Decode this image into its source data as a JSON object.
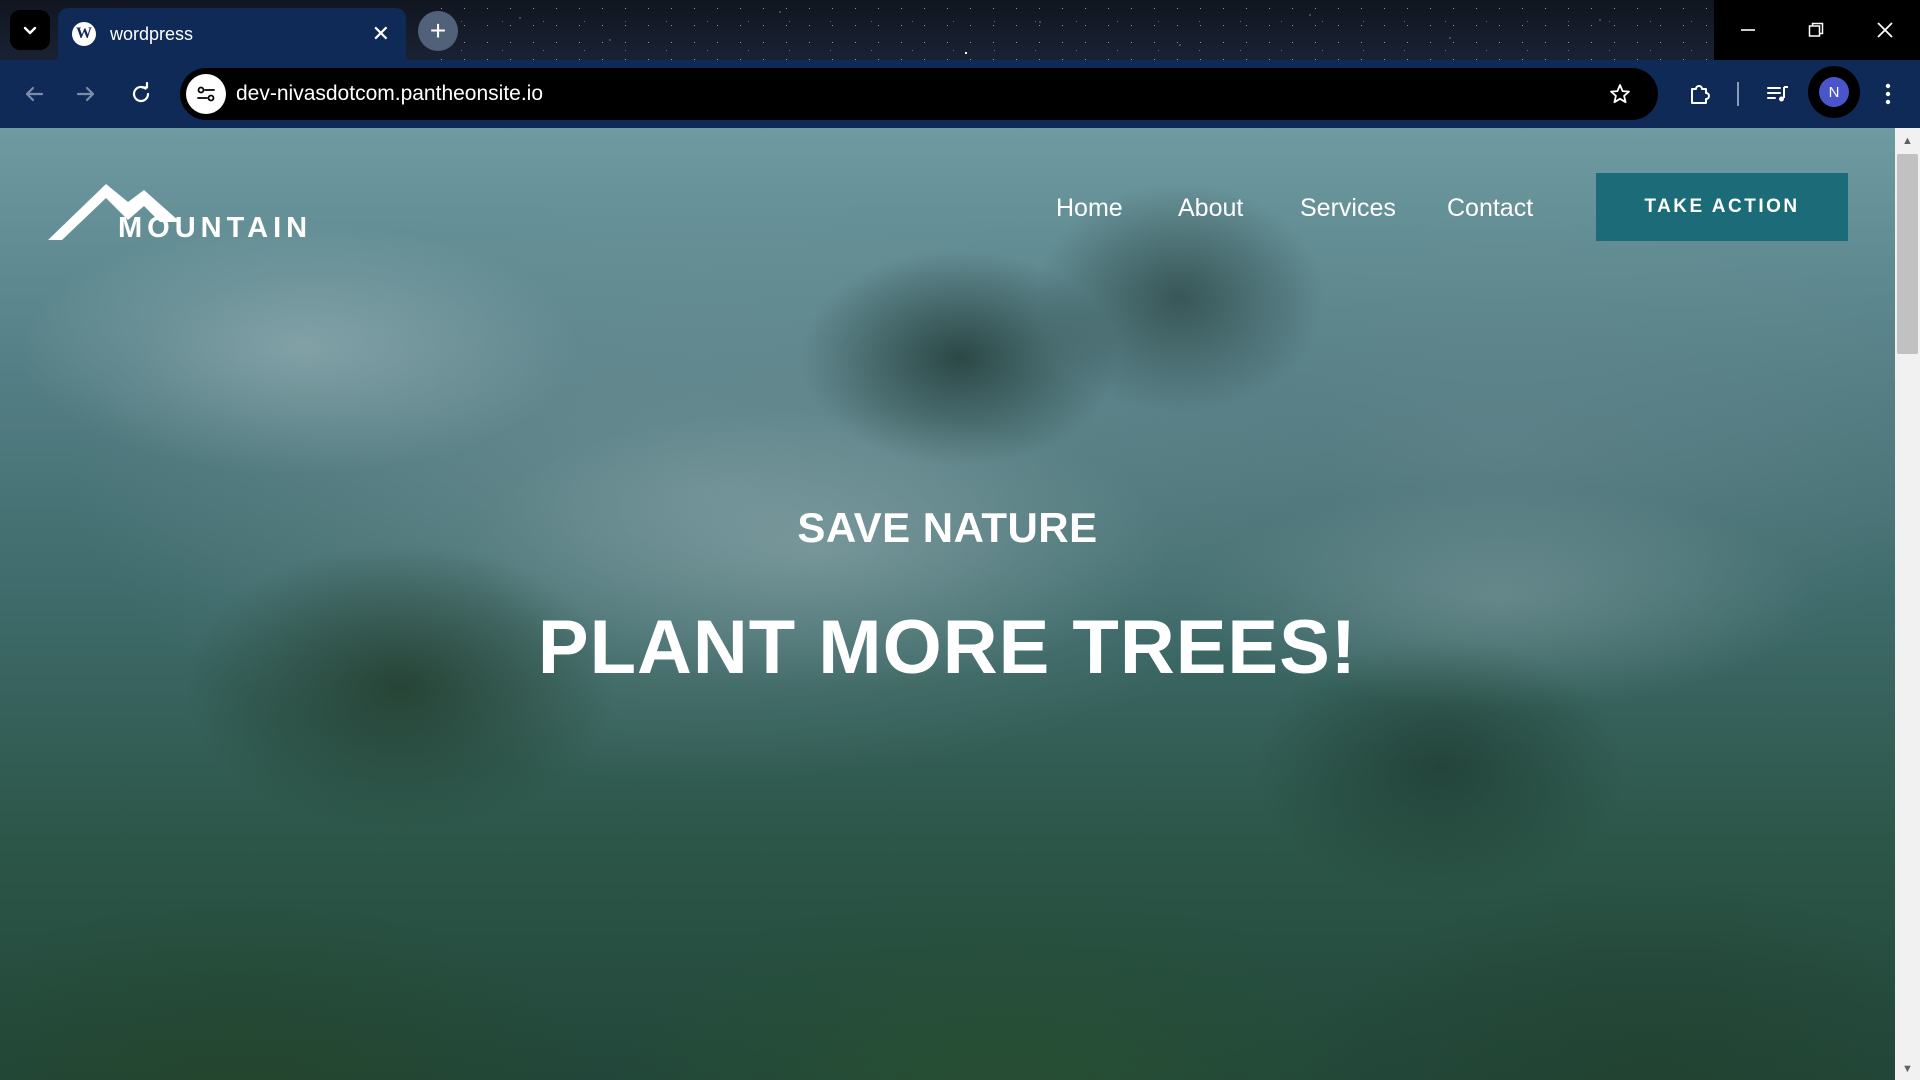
{
  "browser": {
    "tab": {
      "title": "wordpress",
      "favicon": "wordpress-logo"
    },
    "address": {
      "url": "dev-nivasdotcom.pantheonsite.io"
    },
    "profile_initial": "N"
  },
  "site": {
    "logo_text": "MOUNTAIN",
    "nav": [
      "Home",
      "About",
      "Services",
      "Contact"
    ],
    "cta_label": "TAKE ACTION",
    "hero": {
      "subtitle": "SAVE NATURE",
      "title": "PLANT MORE TREES!"
    }
  },
  "colors": {
    "chrome_blue": "#0f2a57",
    "cta_teal": "#1b6b78",
    "avatar": "#4a55c9"
  }
}
